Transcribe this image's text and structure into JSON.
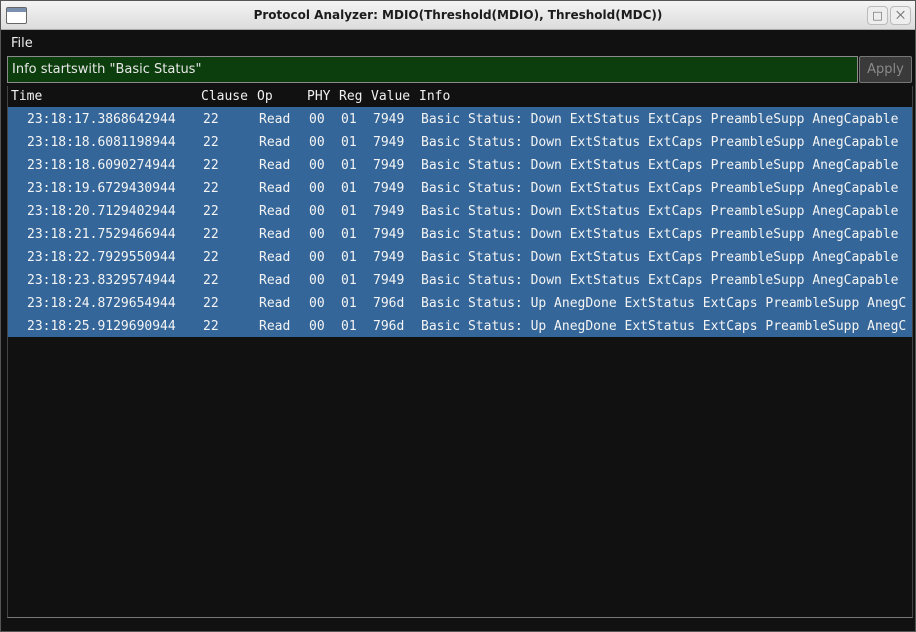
{
  "window": {
    "title": "Protocol Analyzer: MDIO(Threshold(MDIO), Threshold(MDC))",
    "maximize_glyph": "□",
    "close_glyph": "⨉"
  },
  "menu": {
    "file_label": "File"
  },
  "filter": {
    "value": "Info startswith \"Basic Status\"",
    "apply_label": "Apply"
  },
  "columns": [
    "Time",
    "Clause",
    "Op",
    "PHY",
    "Reg",
    "Value",
    "Info"
  ],
  "rows": [
    {
      "time": "23:18:17.3868642944",
      "clause": "22",
      "op": "Read",
      "phy": "00",
      "reg": "01",
      "value": "7949",
      "info": "Basic Status: Down ExtStatus ExtCaps PreambleSupp AnegCapable"
    },
    {
      "time": "23:18:18.6081198944",
      "clause": "22",
      "op": "Read",
      "phy": "00",
      "reg": "01",
      "value": "7949",
      "info": "Basic Status: Down ExtStatus ExtCaps PreambleSupp AnegCapable"
    },
    {
      "time": "23:18:18.6090274944",
      "clause": "22",
      "op": "Read",
      "phy": "00",
      "reg": "01",
      "value": "7949",
      "info": "Basic Status: Down ExtStatus ExtCaps PreambleSupp AnegCapable"
    },
    {
      "time": "23:18:19.6729430944",
      "clause": "22",
      "op": "Read",
      "phy": "00",
      "reg": "01",
      "value": "7949",
      "info": "Basic Status: Down ExtStatus ExtCaps PreambleSupp AnegCapable"
    },
    {
      "time": "23:18:20.7129402944",
      "clause": "22",
      "op": "Read",
      "phy": "00",
      "reg": "01",
      "value": "7949",
      "info": "Basic Status: Down ExtStatus ExtCaps PreambleSupp AnegCapable"
    },
    {
      "time": "23:18:21.7529466944",
      "clause": "22",
      "op": "Read",
      "phy": "00",
      "reg": "01",
      "value": "7949",
      "info": "Basic Status: Down ExtStatus ExtCaps PreambleSupp AnegCapable"
    },
    {
      "time": "23:18:22.7929550944",
      "clause": "22",
      "op": "Read",
      "phy": "00",
      "reg": "01",
      "value": "7949",
      "info": "Basic Status: Down ExtStatus ExtCaps PreambleSupp AnegCapable"
    },
    {
      "time": "23:18:23.8329574944",
      "clause": "22",
      "op": "Read",
      "phy": "00",
      "reg": "01",
      "value": "7949",
      "info": "Basic Status: Down ExtStatus ExtCaps PreambleSupp AnegCapable"
    },
    {
      "time": "23:18:24.8729654944",
      "clause": "22",
      "op": "Read",
      "phy": "00",
      "reg": "01",
      "value": "796d",
      "info": "Basic Status: Up AnegDone ExtStatus ExtCaps PreambleSupp AnegC"
    },
    {
      "time": "23:18:25.9129690944",
      "clause": "22",
      "op": "Read",
      "phy": "00",
      "reg": "01",
      "value": "796d",
      "info": "Basic Status: Up AnegDone ExtStatus ExtCaps PreambleSupp AnegC"
    }
  ],
  "colors": {
    "selected_row": "#346699",
    "background": "#111111",
    "filter_bg": "#0c3d0c"
  }
}
